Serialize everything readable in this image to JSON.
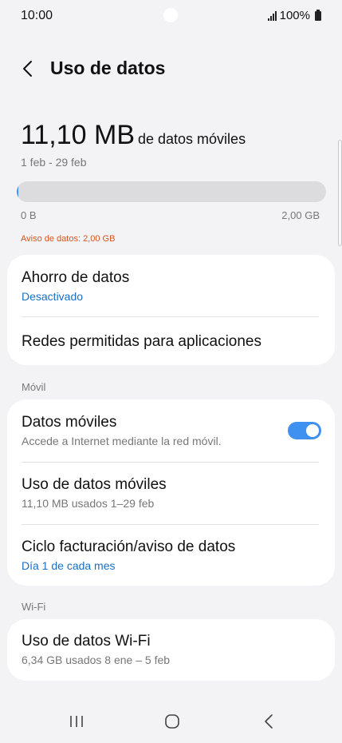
{
  "status_bar": {
    "time": "10:00",
    "battery": "100%"
  },
  "header": {
    "title": "Uso de datos"
  },
  "usage": {
    "amount": "11,10 MB",
    "suffix": "de datos móviles",
    "period": "1 feb - 29 feb",
    "bar_fill_fraction": 0.005,
    "bar_min_label": "0 B",
    "bar_max_label": "2,00 GB",
    "warning": "Aviso de datos: 2,00 GB"
  },
  "card1": {
    "data_saver": {
      "title": "Ahorro de datos",
      "status": "Desactivado"
    },
    "allowed_networks": {
      "title": "Redes permitidas para aplicaciones"
    }
  },
  "mobile_section": {
    "label": "Móvil",
    "mobile_data": {
      "title": "Datos móviles",
      "subtitle": "Accede a Internet mediante la red móvil.",
      "enabled": true
    },
    "mobile_usage": {
      "title": "Uso de datos móviles",
      "subtitle": "11,10 MB usados 1–29 feb"
    },
    "billing_cycle": {
      "title": "Ciclo facturación/aviso de datos",
      "subtitle": "Día 1 de cada mes"
    }
  },
  "wifi_section": {
    "label": "Wi-Fi",
    "wifi_usage": {
      "title": "Uso de datos Wi-Fi",
      "subtitle": "6,34 GB usados 8 ene – 5 feb"
    }
  },
  "colors": {
    "accent": "#3e91f0",
    "link_blue": "#1a6fc4",
    "warning": "#d9541c"
  }
}
